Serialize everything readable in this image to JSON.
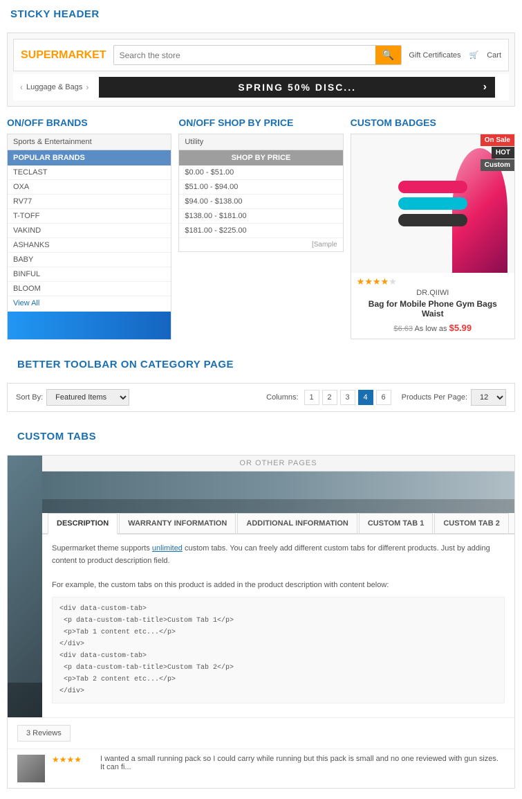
{
  "sticky_header": {
    "section_title": "STICKY HEADER",
    "logo": "SUPERMARKET",
    "search_placeholder": "Search the store",
    "actions": {
      "gift": "Gift Certificates",
      "cart": "Cart"
    },
    "nav": {
      "item": "Luggage & Bags"
    },
    "banner_text": "SPRING 50% DISC..."
  },
  "brands": {
    "section_title": "ON/OFF BRANDS",
    "category": "Sports & Entertainment",
    "popular_header": "POPULAR BRANDS",
    "items": [
      "TECLAST",
      "OXA",
      "RV77",
      "T-TOFF",
      "VAKIND",
      "ASHANKS",
      "BABY",
      "BINFUL",
      "BLOOM"
    ],
    "view_all": "View All"
  },
  "shop_by_price": {
    "section_title": "ON/OFF SHOP BY PRICE",
    "header": "Utility",
    "sub_header": "SHOP BY PRICE",
    "ranges": [
      "$0.00 - $51.00",
      "$51.00 - $94.00",
      "$94.00 - $138.00",
      "$138.00 - $181.00",
      "$181.00 - $225.00"
    ],
    "sample_label": "[Sample"
  },
  "custom_badges": {
    "section_title": "CUSTOM BADGES",
    "badge_on_sale": "On Sale",
    "badge_hot": "HOT",
    "badge_custom": "Custom",
    "stars": 4,
    "total_stars": 5,
    "seller": "DR.QIIWI",
    "product_name": "Bag for Mobile Phone Gym Bags Waist",
    "old_price": "$6.63",
    "as_low_as": "As low as",
    "new_price": "$5.99"
  },
  "toolbar": {
    "section_title": "BETTER TOOLBAR ON CATEGORY PAGE",
    "sort_label": "Sort By:",
    "sort_value": "Featured Items",
    "columns_label": "Columns:",
    "column_options": [
      "1",
      "2",
      "3",
      "4",
      "6"
    ],
    "active_column": "4",
    "per_page_label": "Products Per Page:",
    "per_page_value": "12"
  },
  "custom_tabs": {
    "section_title": "CUSTOM TABS",
    "or_bar": "OR OTHER PAGES",
    "tabs": [
      "DESCRIPTION",
      "WARRANTY INFORMATION",
      "ADDITIONAL INFORMATION",
      "CUSTOM TAB 1",
      "CUSTOM TAB 2"
    ],
    "active_tab": "DESCRIPTION",
    "content_line1": "Supermarket theme supports unlimited custom tabs. You can freely add different custom tabs for different products. Just by adding content to product description field.",
    "content_link": "unlimited",
    "content_line2": "For example, the custom tabs on this product is added in the product description with content below:",
    "code_block": "<div data-custom-tab>\n <p data-custom-tab-title>Custom Tab 1</p>\n <p>Tab 1 content etc...</p>\n</div>\n<div data-custom-tab>\n <p data-custom-tab-title>Custom Tab 2</p>\n <p>Tab 2 content etc...</p>\n</div>",
    "reviews_label": "3 Reviews",
    "review_stars": "★★★★",
    "review_text": "I wanted a small running pack so I could carry while running but this pack is small and no one reviewed with gun sizes. It can fi..."
  }
}
